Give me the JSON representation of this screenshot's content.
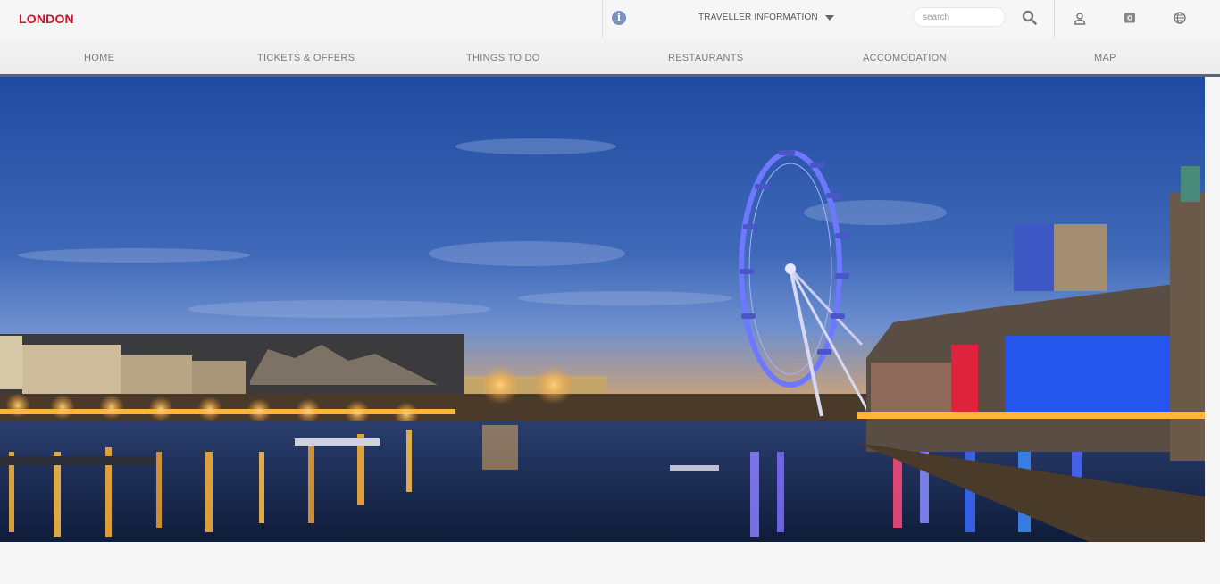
{
  "brand": {
    "name": "LONDON",
    "color": "#d0102b"
  },
  "header": {
    "info_icon": "info-circle-icon",
    "traveller_label": "TRAVELLER INFORMATION",
    "search_placeholder": "search",
    "icons": [
      "search-icon",
      "user-icon",
      "camera-icon",
      "globe-icon"
    ]
  },
  "nav": {
    "items": [
      {
        "label": "HOME"
      },
      {
        "label": "TICKETS & OFFERS"
      },
      {
        "label": "THINGS TO DO"
      },
      {
        "label": "RESTAURANTS"
      },
      {
        "label": "ACCOMODATION"
      },
      {
        "label": "MAP"
      }
    ],
    "underline_color": "#5a6380"
  },
  "hero": {
    "subject": "London Eye and River Thames at dusk",
    "colors": {
      "sky_top": "#1f4aa0",
      "sky_bottom": "#5b7fc6",
      "wheel": "#6d78ff",
      "lights": "#ffb43a"
    }
  }
}
